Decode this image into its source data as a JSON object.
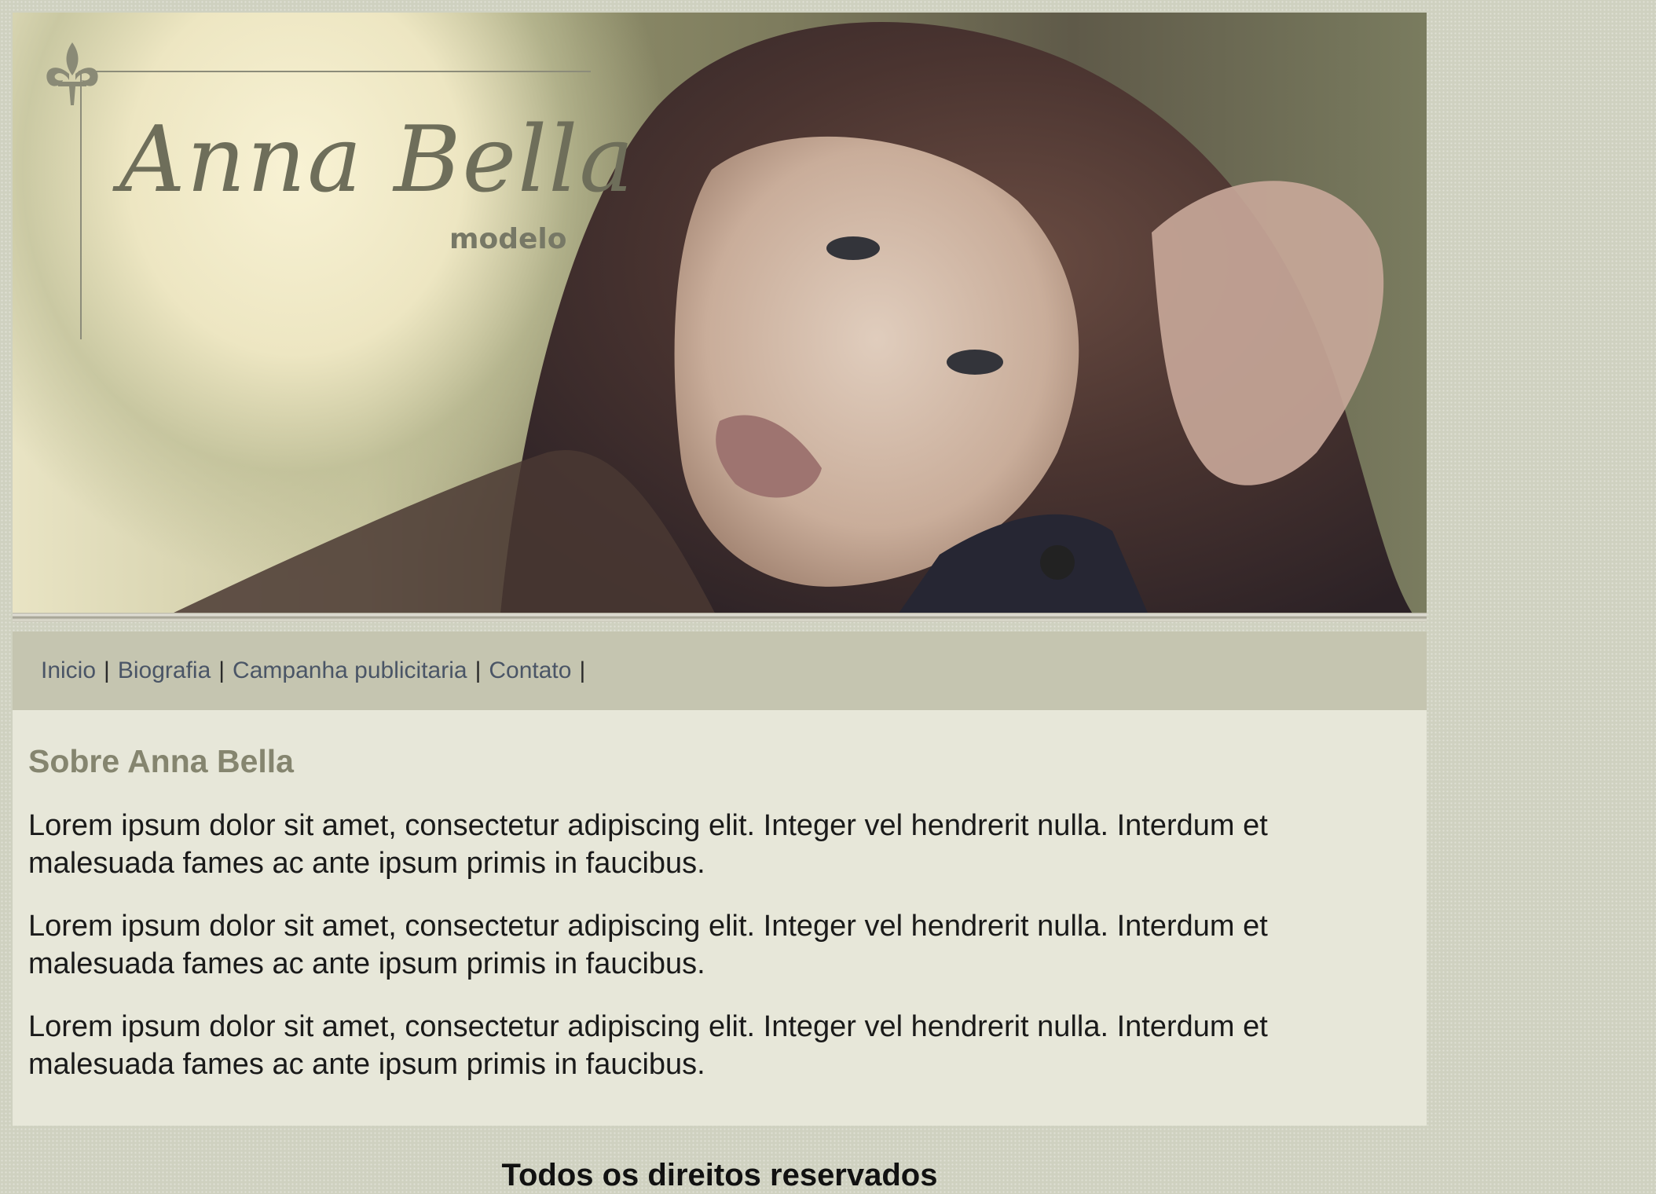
{
  "banner": {
    "logo_name": "Anna Bella",
    "logo_sub": "modelo",
    "photo": "woman-portrait-photo"
  },
  "nav": {
    "items": [
      {
        "label": "Inicio"
      },
      {
        "label": "Biografia"
      },
      {
        "label": "Campanha publicitaria"
      },
      {
        "label": "Contato"
      }
    ],
    "separator": "|"
  },
  "content": {
    "heading": "Sobre Anna Bella",
    "paragraphs": [
      "Lorem ipsum dolor sit amet, consectetur adipiscing elit. Integer vel hendrerit nulla. Interdum et malesuada fames ac ante ipsum primis in faucibus.",
      "Lorem ipsum dolor sit amet, consectetur adipiscing elit. Integer vel hendrerit nulla. Interdum et malesuada fames ac ante ipsum primis in faucibus.",
      "Lorem ipsum dolor sit amet, consectetur adipiscing elit. Integer vel hendrerit nulla. Interdum et malesuada fames ac ante ipsum primis in faucibus."
    ]
  },
  "footer": {
    "text": "Todos os direitos reservados"
  },
  "colors": {
    "page_bg": "#cfd1c0",
    "nav_bg": "#c5c5b0",
    "content_bg": "#e7e7d9",
    "heading": "#85856f",
    "link": "#4a5566"
  }
}
